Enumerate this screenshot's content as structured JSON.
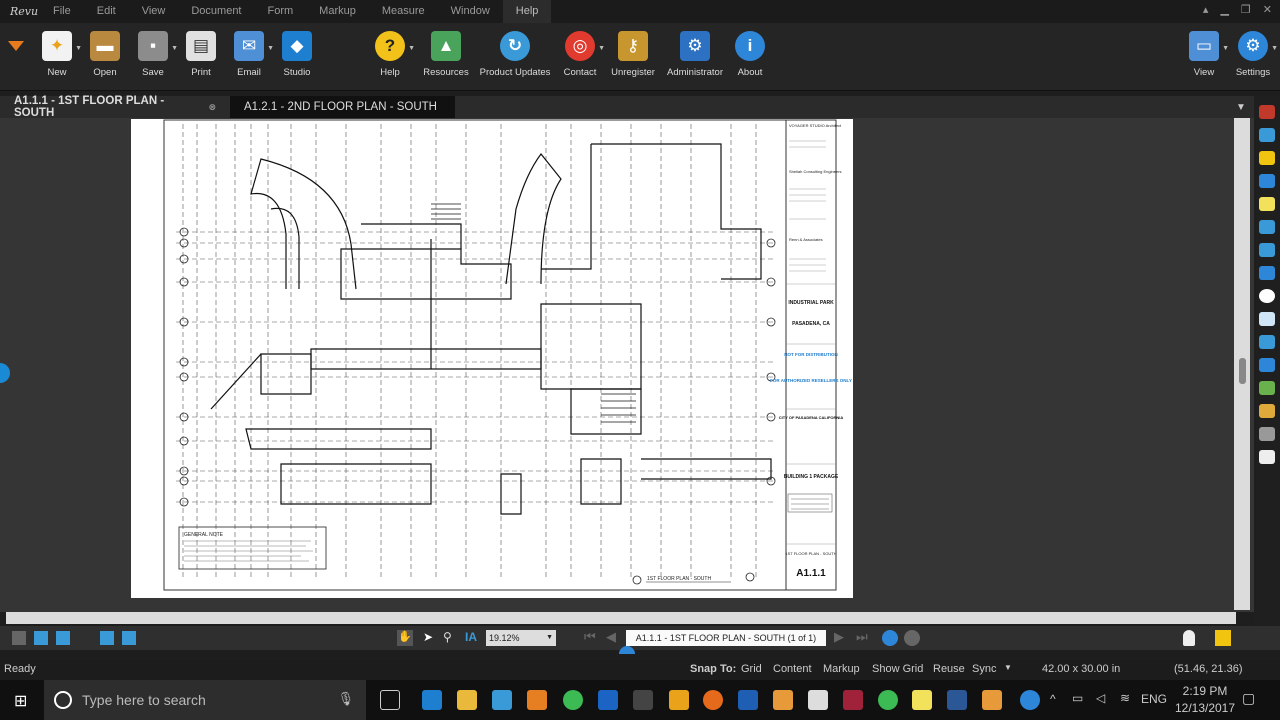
{
  "menubar": {
    "logo": "Revu",
    "items": [
      "File",
      "Edit",
      "View",
      "Document",
      "Form",
      "Markup",
      "Measure",
      "Window",
      "Help"
    ]
  },
  "ribbon": {
    "left": [
      {
        "label": "New",
        "icon": "new-document-icon"
      },
      {
        "label": "Open",
        "icon": "folder-icon"
      },
      {
        "label": "Save",
        "icon": "save-icon"
      },
      {
        "label": "Print",
        "icon": "printer-icon"
      },
      {
        "label": "Email",
        "icon": "email-icon"
      },
      {
        "label": "Studio",
        "icon": "studio-icon"
      }
    ],
    "center": [
      {
        "label": "Help",
        "icon": "help-icon"
      },
      {
        "label": "Resources",
        "icon": "resources-icon"
      },
      {
        "label": "Product Updates",
        "icon": "product-updates-icon"
      },
      {
        "label": "Contact",
        "icon": "lifebuoy-icon"
      },
      {
        "label": "Unregister",
        "icon": "key-icon"
      },
      {
        "label": "Administrator",
        "icon": "administrator-icon"
      },
      {
        "label": "About",
        "icon": "info-icon"
      }
    ],
    "right": [
      {
        "label": "View",
        "icon": "monitor-icon"
      },
      {
        "label": "Settings",
        "icon": "settings-icon"
      }
    ]
  },
  "tabs": [
    {
      "label": "A1.1.1 - 1ST FLOOR PLAN - SOUTH",
      "active": true
    },
    {
      "label": "A1.2.1 - 2ND FLOOR PLAN - SOUTH",
      "active": false
    }
  ],
  "drawing": {
    "title_block": {
      "studio": "VOYAGER STUDIO Architect",
      "consultant1": "Shellah Consulting Engineers",
      "consultant2": "Renn & Associates",
      "project": "INDUSTRIAL PARK",
      "location": "PASADENA, CA",
      "notice1": "NOT FOR DISTRIBUTION",
      "notice2": "FOR AUTHORIZED RESELLERS ONLY",
      "city": "CITY OF PASADENA CALIFORNIA",
      "package": "BUILDING 1 PACKAGE",
      "sheet_name": "1ST FLOOR PLAN - SOUTH",
      "sheet_number": "A1.1.1"
    },
    "general_notes": "GENERAL NOTE",
    "caption": "1ST FLOOR PLAN - SOUTH"
  },
  "navigation": {
    "zoom": "19.12%",
    "page": "A1.1.1 - 1ST FLOOR PLAN - SOUTH (1 of 1)"
  },
  "status": {
    "left": "Ready",
    "snap_to": "Snap To:",
    "options": [
      "Grid",
      "Content",
      "Markup",
      "Show Grid",
      "Reuse",
      "Sync"
    ],
    "dimensions": "42.00 x 30.00 in",
    "coords": "(51.46, 21.36)"
  },
  "taskbar": {
    "search_placeholder": "Type here to search",
    "lang": "ENG",
    "time": "2:19 PM",
    "date": "12/13/2017"
  },
  "colors": {
    "accent": "#1a8ad4",
    "notice_blue": "#1f7fd0"
  }
}
